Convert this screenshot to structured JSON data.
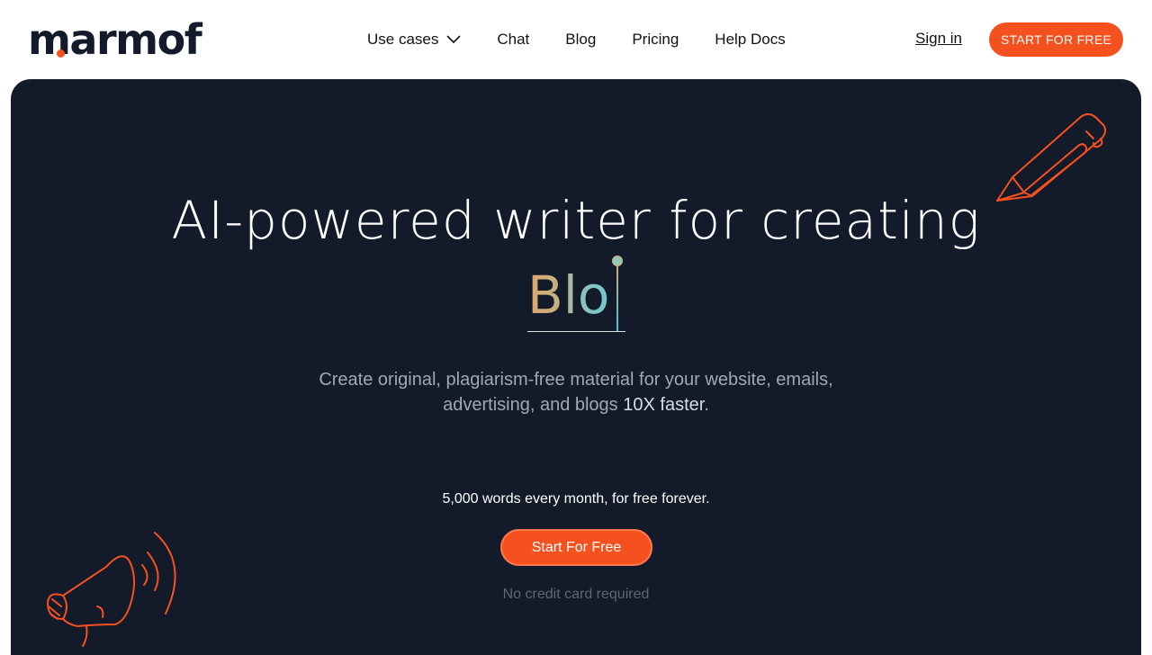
{
  "brand": {
    "logo_text": "marmof",
    "accent": "#f4511e",
    "dark": "#131a2a"
  },
  "nav": {
    "items": [
      {
        "label": "Use cases",
        "icon": "chevron-down-icon"
      },
      {
        "label": "Chat"
      },
      {
        "label": "Blog"
      },
      {
        "label": "Pricing"
      },
      {
        "label": "Help Docs"
      }
    ],
    "sign_in": "Sign in",
    "cta": "START FOR FREE"
  },
  "hero": {
    "title": "AI-powered writer for creating",
    "typed_word": "Blo",
    "subtitle_line1": "Create original, plagiarism-free material for your website, emails,",
    "subtitle_line2_prefix": "advertising, and blogs ",
    "subtitle_line2_strong": "10X faster",
    "subtitle_line2_suffix": ".",
    "free_note": "5,000 words every month, for free forever.",
    "cta": "Start For Free",
    "no_card": "No credit card required",
    "decor_icons": [
      "pencil-icon",
      "megaphone-icon"
    ]
  }
}
